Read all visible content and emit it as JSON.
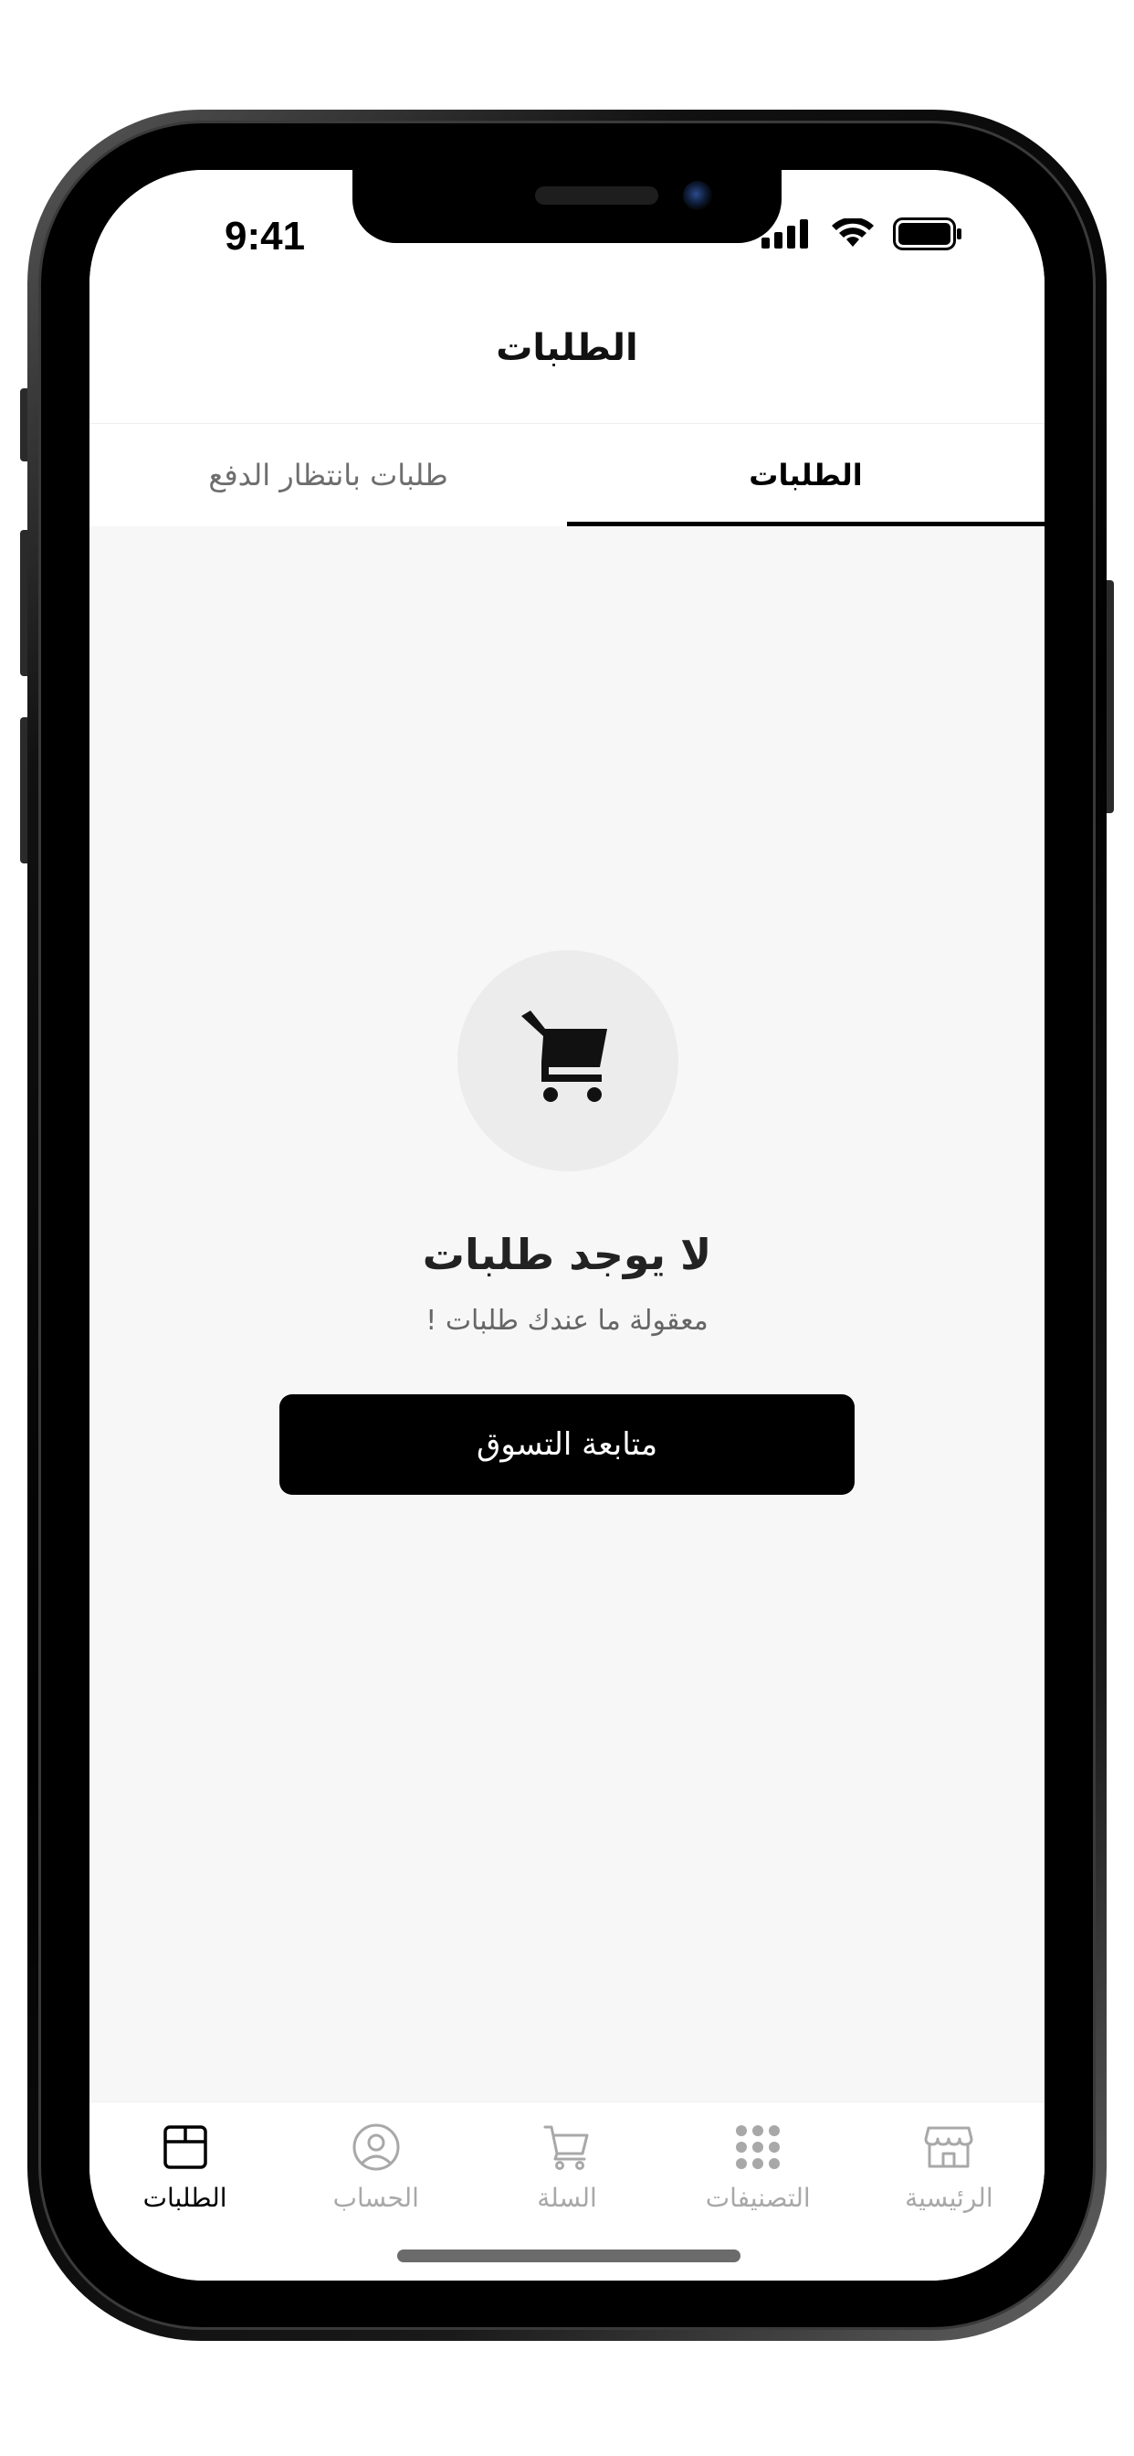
{
  "status_bar": {
    "time": "9:41"
  },
  "header": {
    "title": "الطلبات"
  },
  "tabs": [
    {
      "label": "الطلبات",
      "active": true
    },
    {
      "label": "طلبات بانتظار الدفع",
      "active": false
    }
  ],
  "empty_state": {
    "icon": "cart-icon",
    "title": "لا يوجد طلبات",
    "subtitle": "معقولة ما عندك طلبات !",
    "button_label": "متابعة التسوق"
  },
  "bottom_nav": {
    "items": [
      {
        "label": "الرئيسية",
        "icon": "store-icon",
        "active": false
      },
      {
        "label": "التصنيفات",
        "icon": "grid-icon",
        "active": false
      },
      {
        "label": "السلة",
        "icon": "cart-icon",
        "active": false
      },
      {
        "label": "الحساب",
        "icon": "user-icon",
        "active": false
      },
      {
        "label": "الطلبات",
        "icon": "box-icon",
        "active": true
      }
    ]
  },
  "colors": {
    "accent": "#000000",
    "inactive": "#a8a8a8",
    "background": "#f7f7f7"
  }
}
